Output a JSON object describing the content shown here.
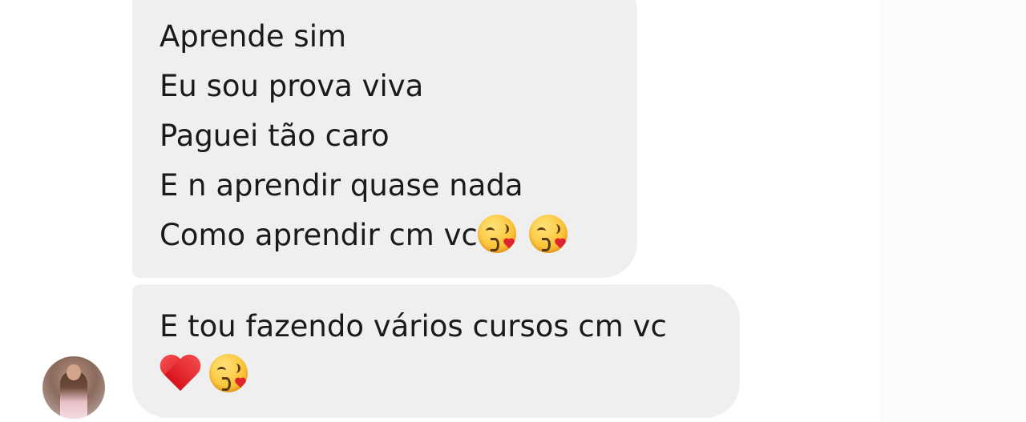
{
  "messages": [
    {
      "lines": [
        "Aprende sim",
        "Eu sou prova viva",
        "Paguei tão caro",
        "E n aprendir quase nada",
        "Como aprendir cm vc"
      ],
      "trailing_emojis": [
        "face-blowing-a-kiss",
        "face-blowing-a-kiss"
      ]
    },
    {
      "lines": [
        "E tou fazendo vários cursos cm vc"
      ],
      "trailing_emojis": [
        "red-heart",
        "face-blowing-a-kiss"
      ]
    }
  ],
  "colors": {
    "bubble": "#efefef",
    "text": "#1a1a1a",
    "background": "#ffffff"
  },
  "icons": {
    "avatar": "contact-profile-photo"
  }
}
